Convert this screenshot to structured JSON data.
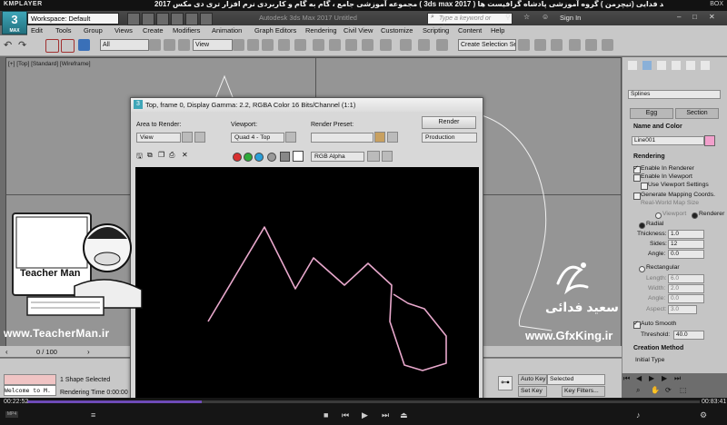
{
  "player": {
    "logo": "KMPLAYER",
    "top_right": "BOX",
    "course_title": "مجموعه آموزشی جامع ، گام به گام و کاربردی نرم افزار تری دی مکس 2017  ( 3ds max 2017 )  مدرس : سعید فدایی (تیچرمن ) گروه آموزشی پادشاه گرافیست ها",
    "time_elapsed": "00:22:52",
    "time_total": "00:83:41",
    "progress": 0.26,
    "badge": "MP4"
  },
  "app": {
    "max_button": "3",
    "max_button_sub": "MAX",
    "workspace": "Workspace: Default",
    "title": "Autodesk 3ds Max 2017    Untitled",
    "search_placeholder": "Type a keyword or phrase",
    "sign_in": "Sign In"
  },
  "menu": [
    "Edit",
    "Tools",
    "Group",
    "Views",
    "Create",
    "Modifiers",
    "Animation",
    "Graph Editors",
    "Rendering",
    "Civil View",
    "Customize",
    "Scripting",
    "Content",
    "Help"
  ],
  "toolbar": {
    "selection_filter": "All",
    "view_dropdown": "View",
    "create_selection_set": "Create Selection Se"
  },
  "viewports": {
    "top_left_label": "[+] [Top] [Standard] [Wireframe]"
  },
  "command_panel": {
    "category": "Splines",
    "buttons": [
      "Egg",
      "Section"
    ],
    "name_and_color_title": "Name and Color",
    "object_name": "Line001",
    "object_color": "#f2a0cc",
    "rendering_title": "Rendering",
    "enable_in_renderer": "Enable In Renderer",
    "enable_in_viewport": "Enable In Viewport",
    "use_viewport_settings": "Use Viewport Settings",
    "generate_mapping": "Generate Mapping Coords.",
    "real_world_map": "Real-World Map Size",
    "viewport_label": "Viewport",
    "renderer_label": "Renderer",
    "radial": "Radial",
    "thickness_label": "Thickness:",
    "thickness": "1.0",
    "sides_label": "Sides:",
    "sides": "12",
    "angle_label": "Angle:",
    "angle": "0.0",
    "rectangular": "Rectangular",
    "length_label": "Length:",
    "length": "6.0",
    "width_label": "Width:",
    "width": "2.0",
    "angle2_label": "Angle:",
    "angle2": "0.0",
    "aspect_label": "Aspect:",
    "aspect": "3.0",
    "auto_smooth": "Auto Smooth",
    "threshold_label": "Threshold:",
    "threshold": "40.0",
    "creation_method": "Creation Method",
    "initial_type": "Initial Type"
  },
  "render_window": {
    "title": "Top, frame 0, Display Gamma: 2.2, RGBA Color 16 Bits/Channel (1:1)",
    "area_label": "Area to Render:",
    "area_value": "View",
    "viewport_label": "Viewport:",
    "viewport_value": "Quad 4 - Top",
    "preset_label": "Render Preset:",
    "preset_value": "",
    "render_button": "Render",
    "production": "Production",
    "channel": "RGB Alpha",
    "channel_colors": [
      "#d83030",
      "#2faa3a",
      "#2a9fd8",
      "#9a9a9a"
    ]
  },
  "overlays": {
    "teacher_brand": "Teacher Man",
    "teacher_url": "www.TeacherMan.ir",
    "gfx_name": "سعید فدائی",
    "gfx_url": "www.GfxKing.ir"
  },
  "timeline": {
    "frame_label": "0 / 100",
    "tick_85": "85",
    "tick_90": "90",
    "tick_100": "100"
  },
  "status": {
    "shapes_selected": "1 Shape Selected",
    "rendering_time": "Rendering Time  0:00:00",
    "welcome": "Welcome to M.",
    "auto_key": "Auto Key",
    "selected": "Selected",
    "set_key": "Set Key",
    "key_filters": "Key Filters..."
  }
}
